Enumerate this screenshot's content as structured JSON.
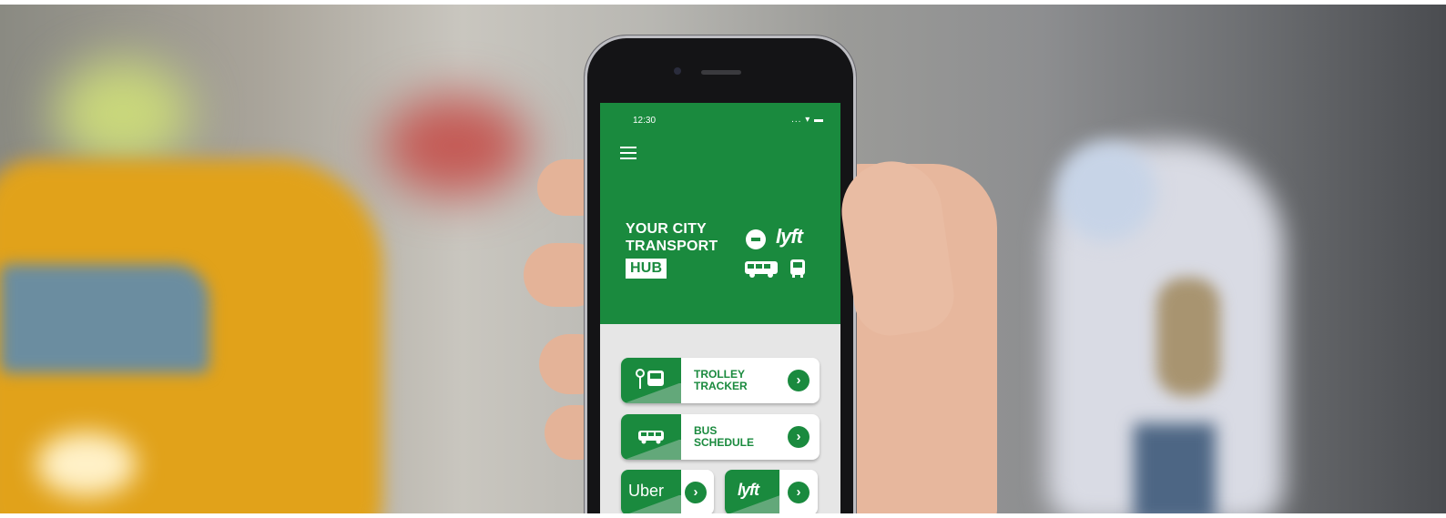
{
  "status_bar": {
    "time": "12:30",
    "indicators": "... ▾ ▬"
  },
  "app": {
    "title_line1": "YOUR CITY",
    "title_line2": "TRANSPORT",
    "title_badge": "HUB",
    "brand_lyft": "lyft"
  },
  "menu": [
    {
      "line1": "TROLLEY",
      "line2": "TRACKER",
      "icon": "trolley-stop-icon",
      "action_icon": "chevron-right-icon"
    },
    {
      "line1": "BUS",
      "line2": "SCHEDULE",
      "icon": "bus-icon",
      "action_icon": "chevron-right-icon"
    }
  ],
  "rideshare": [
    {
      "label": "Uber",
      "action_icon": "chevron-right-icon"
    },
    {
      "label": "lyft",
      "action_icon": "chevron-right-icon"
    }
  ],
  "colors": {
    "brand_green": "#1a8a3e",
    "light_green": "#63a87a",
    "card_bg": "#ffffff",
    "panel_bg": "#e6e6e6"
  }
}
